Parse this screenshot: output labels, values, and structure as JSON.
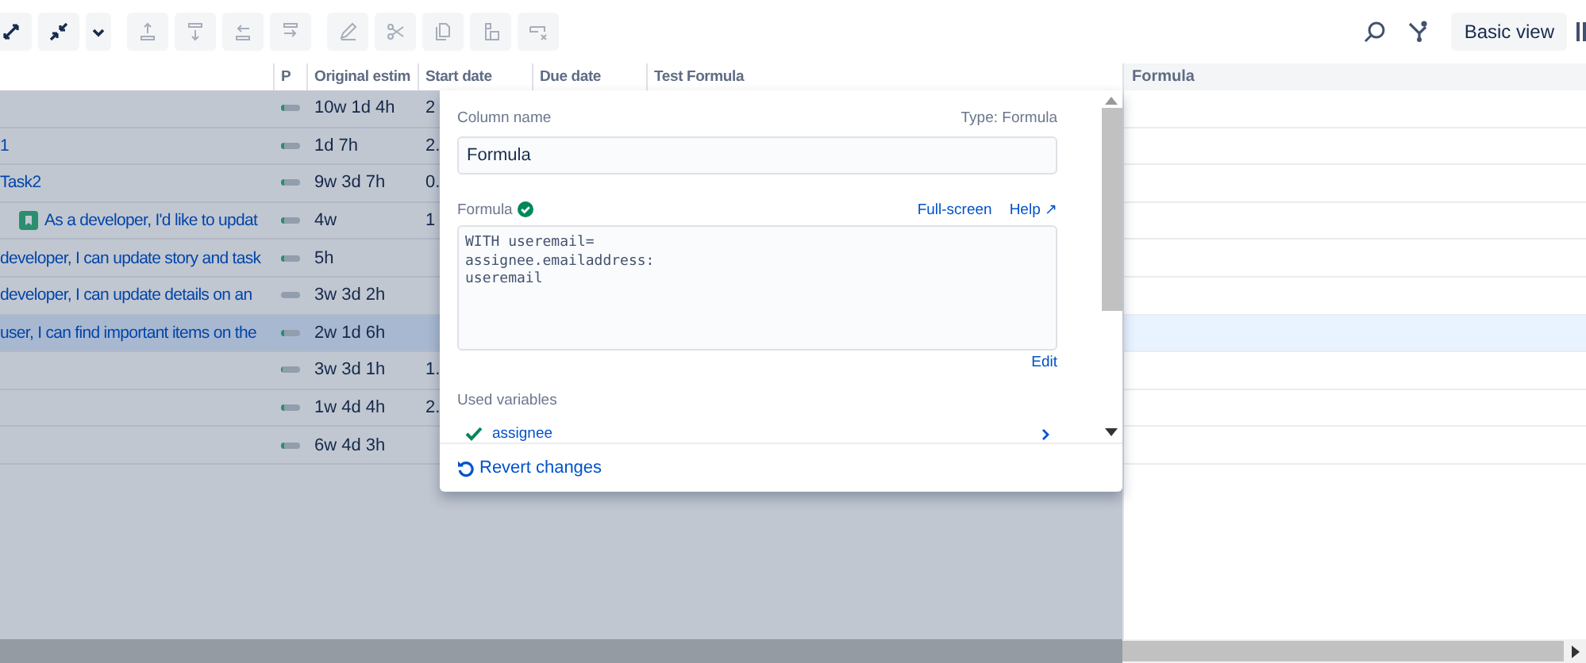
{
  "toolbar": [
    {
      "kind": "expand",
      "disabled": false
    },
    {
      "kind": "collapse",
      "disabled": false
    },
    {
      "kind": "caret",
      "disabled": false
    },
    {
      "kind": "insert-above",
      "disabled": true
    },
    {
      "kind": "insert-below",
      "disabled": true
    },
    {
      "kind": "outdent",
      "disabled": true
    },
    {
      "kind": "indent",
      "disabled": true
    },
    {
      "kind": "edit",
      "disabled": true
    },
    {
      "kind": "cut",
      "disabled": true
    },
    {
      "kind": "copy",
      "disabled": true
    },
    {
      "kind": "paste",
      "disabled": true
    },
    {
      "kind": "clear",
      "disabled": true
    }
  ],
  "view_button": "Basic view",
  "columns": [
    "P",
    "Original estim",
    "Start date",
    "Due date",
    "Test Formula"
  ],
  "right_column": "Formula",
  "rows": [
    {
      "summary": "",
      "issue_icon": false,
      "level": 0.15,
      "estimate": "10w 1d 4h",
      "start": "2",
      "selected": false
    },
    {
      "summary": "1",
      "issue_icon": false,
      "level": 0.15,
      "estimate": "1d 7h",
      "start": "2.",
      "selected": false
    },
    {
      "summary": "Task2",
      "issue_icon": false,
      "level": 0.15,
      "estimate": "9w 3d 7h",
      "start": "0.",
      "selected": false
    },
    {
      "summary": "As a developer, I'd like to updat",
      "issue_icon": true,
      "level": 0.15,
      "estimate": "4w",
      "start": "1",
      "selected": false
    },
    {
      "summary": "developer, I can update story and task",
      "issue_icon": false,
      "level": 0.15,
      "estimate": "5h",
      "start": "",
      "selected": false
    },
    {
      "summary": "developer, I can update details on an",
      "issue_icon": false,
      "level": 0,
      "estimate": "3w 3d 2h",
      "start": "",
      "selected": false
    },
    {
      "summary": "user, I can find important items on the",
      "issue_icon": false,
      "level": 0.15,
      "estimate": "2w 1d 6h",
      "start": "",
      "selected": true
    },
    {
      "summary": "",
      "issue_icon": false,
      "level": 0.1,
      "estimate": "3w 3d 1h",
      "start": "1.",
      "selected": false
    },
    {
      "summary": "",
      "issue_icon": false,
      "level": 0.15,
      "estimate": "1w 4d 4h",
      "start": "2.",
      "selected": false
    },
    {
      "summary": "",
      "issue_icon": false,
      "level": 0.15,
      "estimate": "6w 4d 3h",
      "start": "",
      "selected": false
    }
  ],
  "popup": {
    "name_label": "Column name",
    "type_label": "Type: Formula",
    "name_value": "Formula",
    "formula_label": "Formula",
    "formula_valid": true,
    "fullscreen_link": "Full-screen",
    "help_link": "Help ↗",
    "formula_lines": [
      "WITH useremail=",
      "assignee.emailaddress:",
      "useremail"
    ],
    "edit_link": "Edit",
    "variables_label": "Used variables",
    "variables": [
      {
        "name": "assignee",
        "valid": true
      }
    ],
    "revert": "Revert changes"
  }
}
